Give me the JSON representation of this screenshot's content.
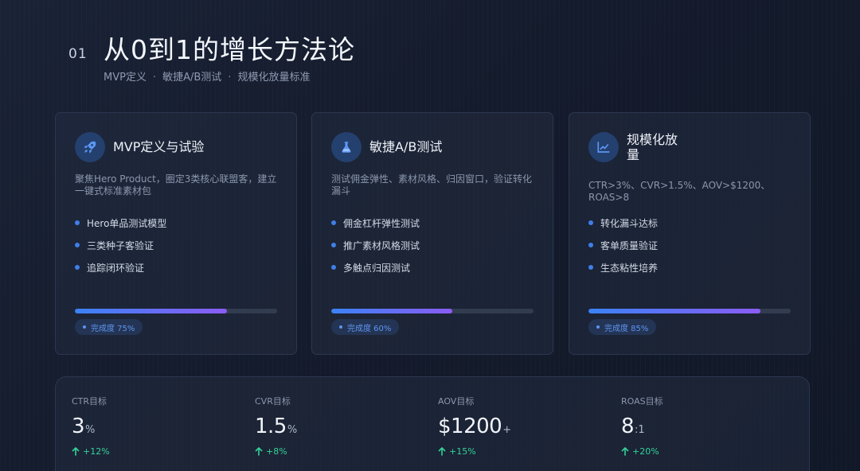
{
  "header": {
    "section_number": "01",
    "title": "从0到1的增长方法论",
    "subtitle_parts": [
      "MVP定义",
      "敏捷A/B测试",
      "规模化放量标准"
    ],
    "separator": "·"
  },
  "cards": [
    {
      "icon": "rocket-icon",
      "title": "MVP定义与试验",
      "description": "聚焦Hero Product，圈定3类核心联盟客，建立一键式标准素材包",
      "items": [
        "Hero单品测试模型",
        "三类种子客验证",
        "追踪闭环验证"
      ],
      "progress": 0.75,
      "progress_label": "完成度 75%"
    },
    {
      "icon": "flask-icon",
      "title": "敏捷A/B测试",
      "description": "测试佣金弹性、素材风格、归因窗口，验证转化漏斗",
      "items": [
        "佣金杠杆弹性测试",
        "推广素材风格测试",
        "多触点归因测试"
      ],
      "progress": 0.6,
      "progress_label": "完成度 60%"
    },
    {
      "icon": "line-chart-icon",
      "title": "规模化放量",
      "description": "CTR>3%、CVR>1.5%、AOV>$1200、ROAS>8",
      "items": [
        "转化漏斗达标",
        "客单质量验证",
        "生态粘性培养"
      ],
      "progress": 0.85,
      "progress_label": "完成度 85%"
    }
  ],
  "stats": [
    {
      "label": "CTR目标",
      "value": "3",
      "unit": "%",
      "change": "+12%"
    },
    {
      "label": "CVR目标",
      "value": "1.5",
      "unit": "%",
      "change": "+8%"
    },
    {
      "label": "AOV目标",
      "value": "$1200",
      "unit": "+",
      "change": "+15%"
    },
    {
      "label": "ROAS目标",
      "value": "8",
      "unit": ":1",
      "change": "+20%"
    }
  ],
  "colors": {
    "accent_blue": "#3b82f6",
    "accent_purple": "#8b5cf6",
    "positive_green": "#34d399",
    "background": "#141b2c"
  }
}
